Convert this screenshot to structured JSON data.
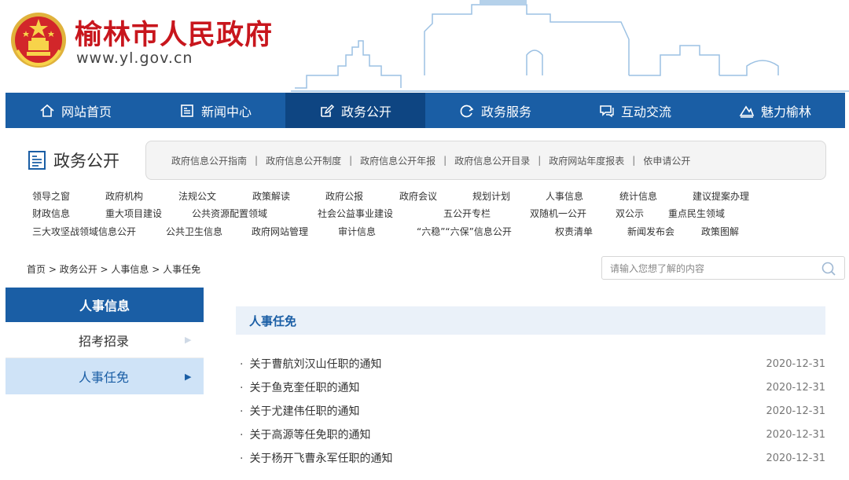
{
  "header": {
    "title": "榆林市人民政府",
    "url": "www.yl.gov.cn"
  },
  "nav": [
    {
      "label": "网站首页",
      "icon": "home-icon"
    },
    {
      "label": "新闻中心",
      "icon": "newspaper-icon"
    },
    {
      "label": "政务公开",
      "icon": "edit-icon",
      "active": true
    },
    {
      "label": "政务服务",
      "icon": "refresh-icon"
    },
    {
      "label": "互动交流",
      "icon": "chat-icon"
    },
    {
      "label": "魅力榆林",
      "icon": "mountain-icon"
    }
  ],
  "panel": {
    "title": "政务公开",
    "sublinks": [
      "政府信息公开指南",
      "政府信息公开制度",
      "政府信息公开年报",
      "政府信息公开目录",
      "政府网站年度报表",
      "依申请公开"
    ],
    "categories": [
      [
        "领导之窗",
        "政府机构",
        "法规公文",
        "政策解读",
        "政府公报",
        "政府会议",
        "规划计划",
        "人事信息",
        "统计信息",
        "建议提案办理"
      ],
      [
        "财政信息",
        "重大项目建设",
        "公共资源配置领域",
        "社会公益事业建设",
        "五公开专栏",
        "双随机一公开",
        "双公示",
        "重点民生领域"
      ],
      [
        "三大攻坚战领域信息公开",
        "公共卫生信息",
        "政府网站管理",
        "审计信息",
        "“六稳”“六保”信息公开",
        "权责清单",
        "新闻发布会",
        "政策图解"
      ]
    ]
  },
  "breadcrumb": [
    "首页",
    "政务公开",
    "人事信息",
    "人事任免"
  ],
  "search": {
    "placeholder": "请输入您想了解的内容"
  },
  "sidebar": {
    "title": "人事信息",
    "items": [
      {
        "label": "招考招录",
        "arrow": "▶"
      },
      {
        "label": "人事任免",
        "arrow": "▶",
        "active": true
      }
    ]
  },
  "content": {
    "title": "人事任免",
    "items": [
      {
        "title": "关于曹航刘汉山任职的通知",
        "date": "2020-12-31"
      },
      {
        "title": "关于鱼克奎任职的通知",
        "date": "2020-12-31"
      },
      {
        "title": "关于尤建伟任职的通知",
        "date": "2020-12-31"
      },
      {
        "title": "关于高源等任免职的通知",
        "date": "2020-12-31"
      },
      {
        "title": "关于杨开飞曹永军任职的通知",
        "date": "2020-12-31"
      }
    ]
  },
  "colors": {
    "brand_red": "#c8161d",
    "nav_blue": "#1a5ea5",
    "nav_active": "#0e4582",
    "side_active": "#cfe3f7"
  }
}
